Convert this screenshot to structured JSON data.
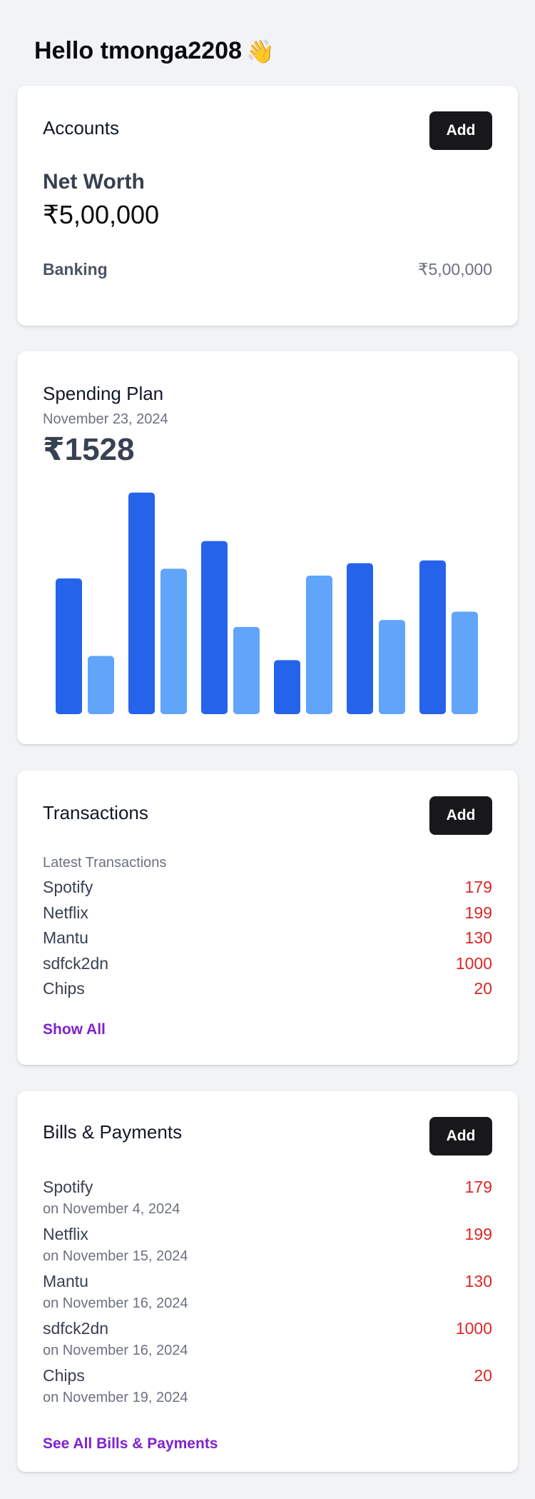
{
  "greeting": {
    "text": "Hello tmonga2208",
    "emoji": "👋"
  },
  "accounts": {
    "title": "Accounts",
    "add_label": "Add",
    "net_worth_label": "Net Worth",
    "net_worth_value": "₹5,00,000",
    "rows": [
      {
        "label": "Banking",
        "value": "₹5,00,000"
      }
    ]
  },
  "spending": {
    "title": "Spending Plan",
    "date": "November 23, 2024",
    "amount": "₹1528"
  },
  "chart_data": {
    "type": "bar",
    "categories": [
      "",
      "",
      "",
      "",
      "",
      ""
    ],
    "series": [
      {
        "color": "#2563eb",
        "values": [
          196,
          320,
          250,
          78,
          218,
          222
        ]
      },
      {
        "color": "#60a5fa",
        "values": [
          84,
          210,
          126,
          200,
          136,
          148
        ]
      }
    ],
    "ylim": [
      0,
      330
    ],
    "grid": false,
    "legend": "none"
  },
  "transactions": {
    "title": "Transactions",
    "add_label": "Add",
    "subtitle": "Latest Transactions",
    "items": [
      {
        "name": "Spotify",
        "amount": "179"
      },
      {
        "name": "Netflix",
        "amount": "199"
      },
      {
        "name": "Mantu",
        "amount": "130"
      },
      {
        "name": "sdfck2dn",
        "amount": "1000"
      },
      {
        "name": "Chips",
        "amount": "20"
      }
    ],
    "show_all_label": "Show All"
  },
  "bills": {
    "title": "Bills & Payments",
    "add_label": "Add",
    "items": [
      {
        "name": "Spotify",
        "amount": "179",
        "date": "on November 4, 2024"
      },
      {
        "name": "Netflix",
        "amount": "199",
        "date": "on November 15, 2024"
      },
      {
        "name": "Mantu",
        "amount": "130",
        "date": "on November 16, 2024"
      },
      {
        "name": "sdfck2dn",
        "amount": "1000",
        "date": "on November 16, 2024"
      },
      {
        "name": "Chips",
        "amount": "20",
        "date": "on November 19, 2024"
      }
    ],
    "see_all_label": "See All Bills & Payments"
  },
  "colors": {
    "background": "#f2f3f5",
    "button": "#18181b",
    "amount_red": "#dc2626",
    "link_purple": "#7e22ce",
    "bar_dark": "#2563eb",
    "bar_light": "#60a5fa"
  }
}
